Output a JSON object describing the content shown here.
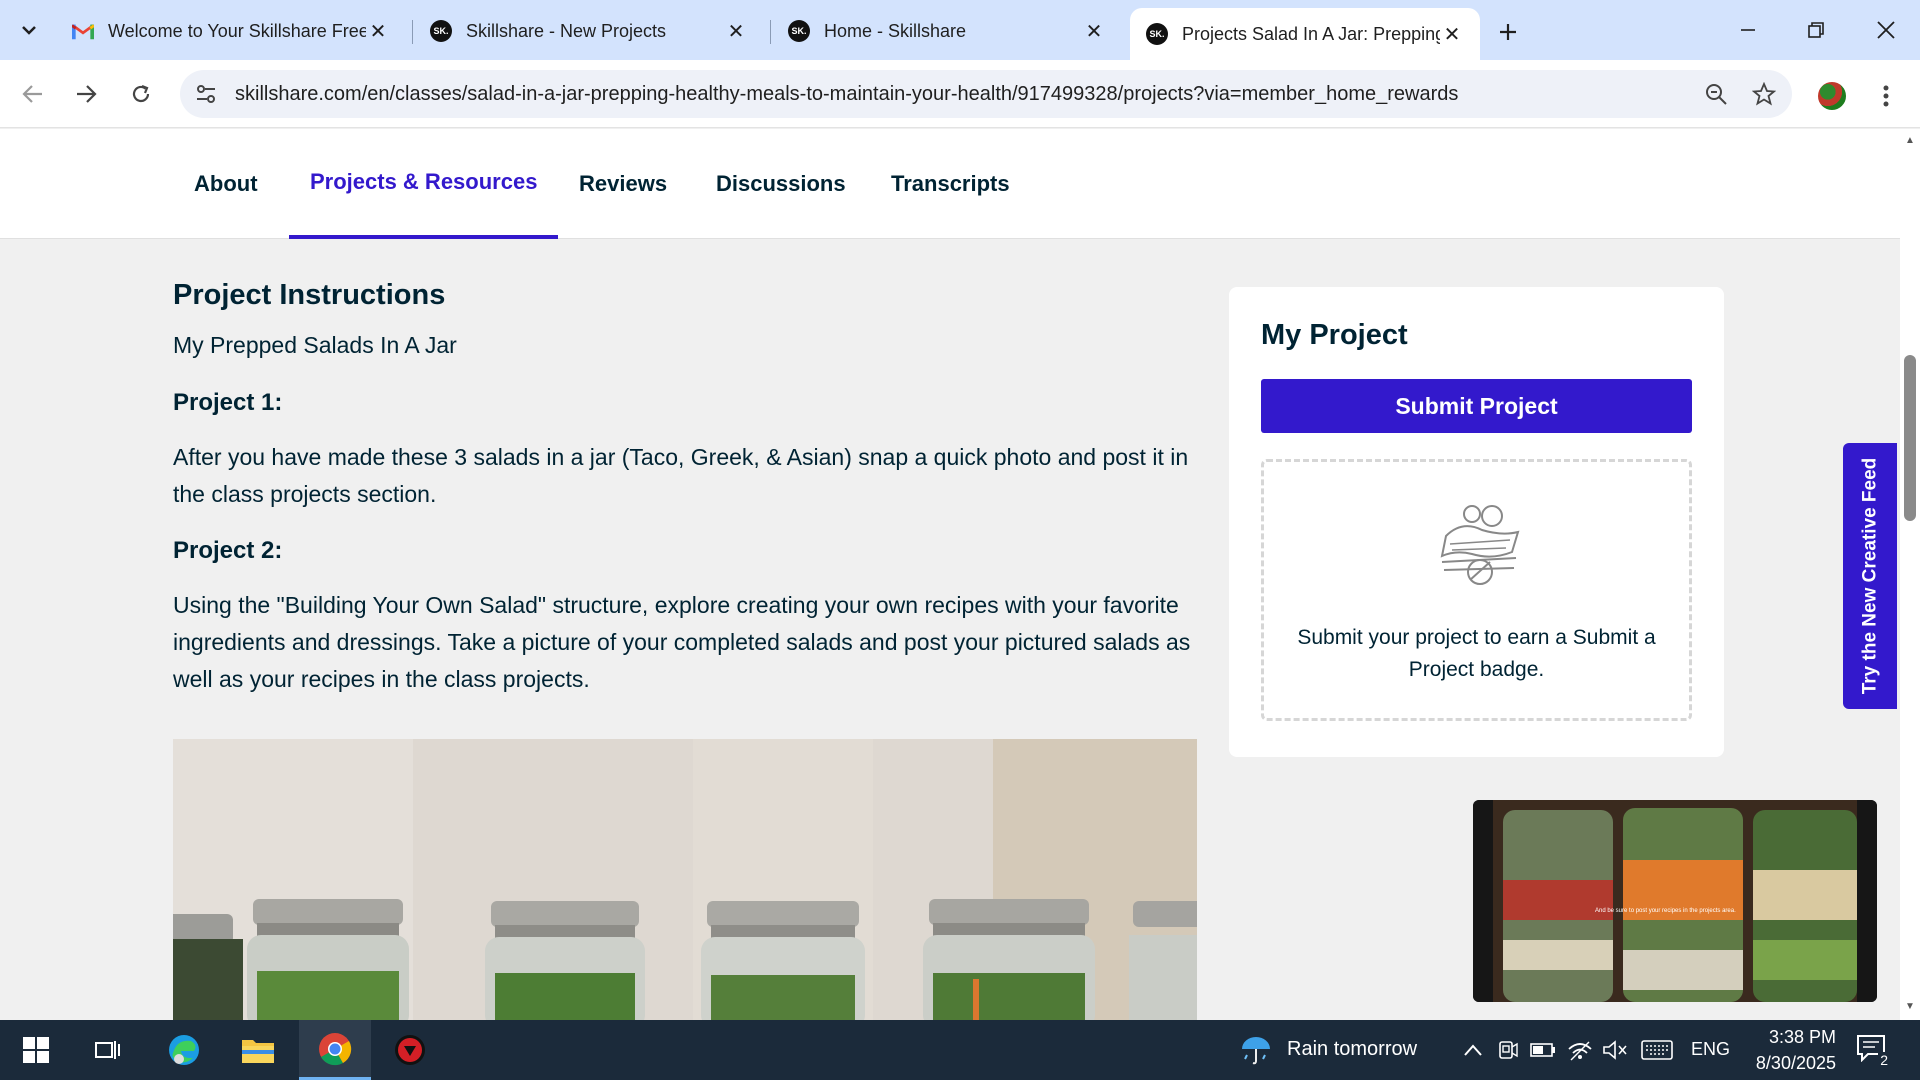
{
  "browser": {
    "tabs": [
      {
        "title": "Welcome to Your Skillshare Free",
        "icon": "gmail-icon"
      },
      {
        "title": "Skillshare - New Projects",
        "icon": "skillshare-icon"
      },
      {
        "title": "Home - Skillshare",
        "icon": "skillshare-icon"
      },
      {
        "title": "Projects Salad In A Jar: Prepping",
        "icon": "skillshare-icon",
        "active": true
      }
    ],
    "favicon_text": "SK.",
    "url": "skillshare.com/en/classes/salad-in-a-jar-prepping-healthy-meals-to-maintain-your-health/917499328/projects?via=member_home_rewards"
  },
  "subnav": {
    "items": [
      "About",
      "Projects & Resources",
      "Reviews",
      "Discussions",
      "Transcripts"
    ],
    "active": "Projects & Resources"
  },
  "instructions": {
    "heading": "Project Instructions",
    "subtitle": "My Prepped Salads In A Jar",
    "project1_heading": "Project 1:",
    "project1_text": "After you have made these 3 salads in a jar (Taco, Greek, & Asian) snap a quick photo and post it in the class projects section.",
    "project2_heading": "Project 2:",
    "project2_text": "Using the \"Building Your Own Salad\" structure, explore creating your own recipes with your favorite ingredients and dressings. Take a picture of your completed salads and post your pictured salads as well as your recipes in the class projects."
  },
  "my_project": {
    "title": "My Project",
    "submit_label": "Submit Project",
    "badge_message": "Submit your project to earn a Submit a Project badge."
  },
  "creative_feed_label": "Try the New Creative Feed",
  "video": {
    "caption": "And be sure to post your recipes in the projects area."
  },
  "taskbar": {
    "weather": "Rain tomorrow",
    "language": "ENG",
    "time": "3:38 PM",
    "date": "8/30/2025",
    "notification_count": "2"
  },
  "colors": {
    "accent": "#3319cc",
    "text": "#002333",
    "tab_strip": "#d3e3fd",
    "taskbar": "#1b2a3a"
  }
}
